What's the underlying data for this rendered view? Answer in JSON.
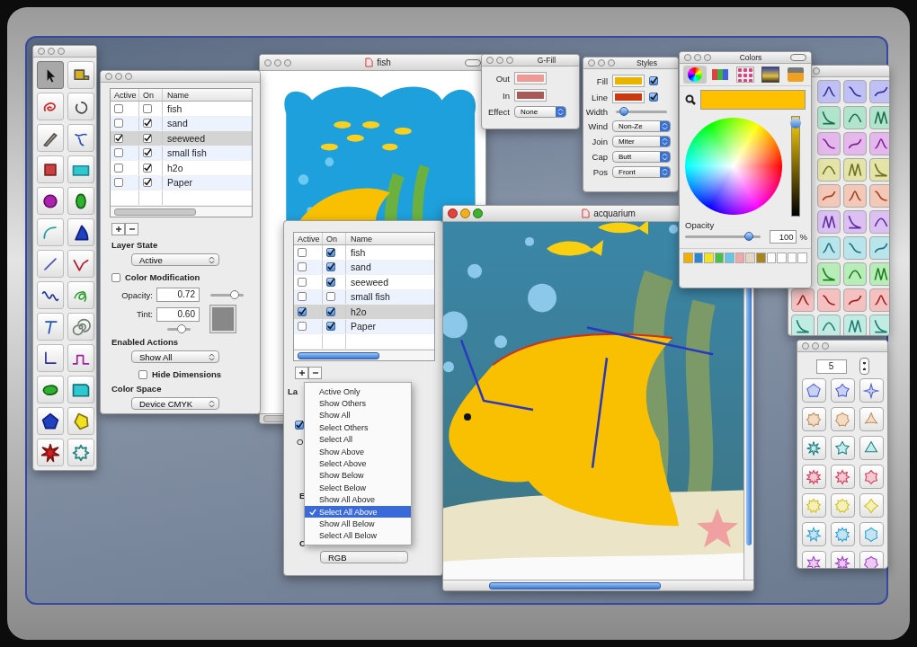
{
  "tools": [
    {
      "selected": true
    },
    {
      "selected": false
    },
    {
      "selected": false
    },
    {
      "selected": false
    },
    {
      "selected": false
    },
    {
      "selected": false
    },
    {
      "selected": false
    },
    {
      "selected": false
    },
    {
      "selected": false
    },
    {
      "selected": false
    },
    {
      "selected": false
    },
    {
      "selected": false
    },
    {
      "selected": false
    },
    {
      "selected": false
    },
    {
      "selected": false
    },
    {
      "selected": false
    },
    {
      "selected": false
    },
    {
      "selected": false
    },
    {
      "selected": false
    },
    {
      "selected": false
    },
    {
      "selected": false
    },
    {
      "selected": false
    },
    {
      "selected": false
    },
    {
      "selected": false
    },
    {
      "selected": false
    },
    {
      "selected": false
    }
  ],
  "layers_panel": {
    "columns": [
      "Active",
      "On",
      "Name"
    ],
    "rows": [
      {
        "name": "fish",
        "active": false,
        "on": false,
        "selected": false
      },
      {
        "name": "sand",
        "active": false,
        "on": true,
        "selected": false
      },
      {
        "name": "seeweed",
        "active": true,
        "on": true,
        "selected": true
      },
      {
        "name": "small fish",
        "active": false,
        "on": true,
        "selected": false
      },
      {
        "name": "h2o",
        "active": false,
        "on": true,
        "selected": false
      },
      {
        "name": "Paper",
        "active": false,
        "on": true,
        "selected": false
      }
    ],
    "layer_state": {
      "label": "Layer State",
      "value": "Active"
    },
    "color_modification": {
      "label": "Color Modification",
      "checked": false
    },
    "opacity": {
      "label": "Opacity:",
      "value": "0.72",
      "level": 0.72
    },
    "tint": {
      "label": "Tint:",
      "value": "0.60",
      "level": 0.6
    },
    "enabled_actions": {
      "label": "Enabled Actions",
      "value": "Show All"
    },
    "hide_dimensions": {
      "label": "Hide Dimensions",
      "checked": false
    },
    "color_space": {
      "label": "Color Space",
      "value": "Device CMYK"
    }
  },
  "fish_window": {
    "title": "fish"
  },
  "gfill_window": {
    "title": "G-Fill",
    "out": {
      "label": "Out",
      "color": "#f09a98"
    },
    "in": {
      "label": "In",
      "color": "#a85a58"
    },
    "effect": {
      "label": "Effect",
      "value": "None"
    }
  },
  "styles_window": {
    "title": "Styles",
    "fill": {
      "label": "Fill",
      "color": "#e8b400",
      "checked": true
    },
    "line": {
      "label": "Line",
      "color": "#c83a10",
      "checked": true
    },
    "width": {
      "label": "Width",
      "level": 0.15
    },
    "popups": [
      {
        "label": "Wind",
        "value": "Non-Ze"
      },
      {
        "label": "Join",
        "value": "Miter"
      },
      {
        "label": "Cap",
        "value": "Butt"
      },
      {
        "label": "Pos",
        "value": "Front"
      }
    ]
  },
  "colors_window": {
    "title": "Colors",
    "modes": [
      {
        "selected": true
      },
      {
        "selected": false
      },
      {
        "selected": false
      },
      {
        "selected": false
      },
      {
        "selected": false
      }
    ],
    "current": {
      "color": "#ffc000"
    },
    "brightness": {
      "level": 0.97
    },
    "opacity": {
      "label": "Opacity",
      "value": "100",
      "unit": "%",
      "level": 0.85
    },
    "swatches": [
      {
        "color": "#f0b000"
      },
      {
        "color": "#2a86d0"
      },
      {
        "color": "#f2e420"
      },
      {
        "color": "#48c048"
      },
      {
        "color": "#64c4e4"
      },
      {
        "color": "#f0a8a8"
      },
      {
        "color": "#e4d8c4"
      },
      {
        "color": "#a88420"
      },
      {
        "color": "#ffffff"
      },
      {
        "color": "#ffffff"
      },
      {
        "color": "#ffffff"
      },
      {
        "color": "#ffffff"
      }
    ]
  },
  "layers_panel_2": {
    "columns": [
      "Active",
      "On",
      "Name"
    ],
    "rows": [
      {
        "name": "fish",
        "active": false,
        "on": true,
        "selected": false
      },
      {
        "name": "sand",
        "active": false,
        "on": true,
        "selected": false
      },
      {
        "name": "seeweed",
        "active": false,
        "on": true,
        "selected": false
      },
      {
        "name": "small fish",
        "active": false,
        "on": false,
        "selected": false
      },
      {
        "name": "h2o",
        "active": true,
        "on": true,
        "selected": true
      },
      {
        "name": "Paper",
        "active": false,
        "on": true,
        "selected": false
      }
    ],
    "layer_state_label": "La",
    "color_modification_checked": true,
    "opacity_label": "O",
    "enabled_actions_label": "E",
    "color_space_label": "C",
    "color_space_value": "RGB",
    "menu": [
      {
        "label": "Active Only",
        "selected": false
      },
      {
        "label": "Show Others",
        "selected": false
      },
      {
        "label": "Show All",
        "selected": false
      },
      {
        "label": "Select Others",
        "selected": false
      },
      {
        "label": "Select All",
        "selected": false
      },
      {
        "label": "Show Above",
        "selected": false
      },
      {
        "label": "Select Above",
        "selected": false
      },
      {
        "label": "Show Below",
        "selected": false
      },
      {
        "label": "Select Below",
        "selected": false
      },
      {
        "label": "Show All Above",
        "selected": false
      },
      {
        "label": "Select All Above",
        "selected": true
      },
      {
        "label": "Show All Below",
        "selected": false
      },
      {
        "label": "Select All Below",
        "selected": false
      }
    ]
  },
  "acquarium_window": {
    "title": "acquarium"
  },
  "shape_palette": {
    "count": "5"
  }
}
